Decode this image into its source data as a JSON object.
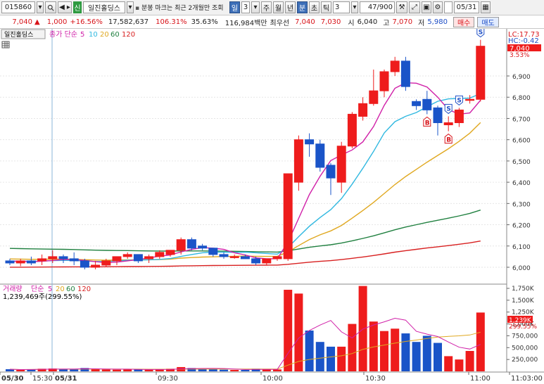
{
  "toolbar": {
    "code": "015860",
    "market_badge": "신",
    "stock_name": "일진홀딩스",
    "marker_notice": "분봉 마크는 최근 2개월만 조회",
    "period_day": "일",
    "period_n": "3",
    "period_week": "주",
    "period_month": "월",
    "period_year": "년",
    "period_minute": "분",
    "period_second": "초",
    "period_tick": "틱",
    "interval": "3",
    "count": "47/900",
    "date": "05/31"
  },
  "quote": {
    "price": "7,040",
    "arrow": "▲",
    "change": "1,000",
    "change_pct": "+16.56%",
    "volume": "17,582,637",
    "volume_ratio": "106.31%",
    "turnover": "35.63%",
    "amount": "116,984백만",
    "best_ask_label": "최우선",
    "best_ask": "7,040",
    "best_bid": "7,030",
    "open_label": "시",
    "open": "6,040",
    "high_label": "고",
    "high": "7,070",
    "low_label": "저",
    "low": "5,980",
    "buy_label": "매수",
    "sell_label": "매도"
  },
  "price_panel": {
    "name_tag": "일진홀딩스",
    "ma_label": "종가 단순",
    "ma_periods": [
      "5",
      "10",
      "20",
      "60",
      "120"
    ],
    "hc_lc": [
      "LC:17.73",
      "HC:-0.42"
    ],
    "last_price_tag": "7,040",
    "last_pct_tag": "3.53%",
    "marker_s": "S",
    "marker_b": "B"
  },
  "volume_panel": {
    "title": "거래량",
    "ma_label": "단순",
    "ma_periods": [
      "5",
      "20",
      "60",
      "120"
    ],
    "info": "1,239,469주(299.55%)",
    "last_vol_tag": "1,239K",
    "last_pct_tag": "299.55%"
  },
  "colors": {
    "up": "#ee1c1c",
    "down": "#1a54c8",
    "ma5": "#d020a8",
    "ma10": "#30b8e0",
    "ma20": "#e0a820",
    "ma60": "#208040",
    "ma120": "#d82020"
  },
  "chart_data": {
    "type": "candlestick",
    "price_axis": {
      "ticks": [
        6000,
        6100,
        6200,
        6300,
        6400,
        6500,
        6600,
        6700,
        6800,
        6900
      ],
      "tick_labels": [
        "6,000",
        "6,100",
        "6,200",
        "6,300",
        "6,400",
        "6,500",
        "6,600",
        "6,700",
        "6,800",
        "6,900"
      ]
    },
    "volume_axis": {
      "ticks": [
        250000,
        500000,
        750000,
        1000000,
        1250000,
        1500000,
        1750000
      ],
      "tick_labels": [
        "250,000",
        "500,000",
        "750,000",
        "1,000K",
        "1,250K",
        "1,500K",
        "1,750K"
      ]
    },
    "time_labels": [
      "05/30",
      "15:30",
      "05/31",
      "09:30",
      "10:00",
      "10:30",
      "11:00",
      "11:03:00"
    ],
    "candles": [
      {
        "o": 6030,
        "h": 6040,
        "l": 6010,
        "c": 6020,
        "v": 45000
      },
      {
        "o": 6020,
        "h": 6040,
        "l": 6005,
        "c": 6030,
        "v": 30000
      },
      {
        "o": 6030,
        "h": 6050,
        "l": 6010,
        "c": 6020,
        "v": 40000
      },
      {
        "o": 6030,
        "h": 6060,
        "l": 6010,
        "c": 6040,
        "v": 55000
      },
      {
        "o": 6040,
        "h": 6080,
        "l": 6020,
        "c": 6050,
        "v": 60000
      },
      {
        "o": 6050,
        "h": 6060,
        "l": 6020,
        "c": 6040,
        "v": 50000
      },
      {
        "o": 6040,
        "h": 6070,
        "l": 6010,
        "c": 6030,
        "v": 40000
      },
      {
        "o": 6030,
        "h": 6040,
        "l": 5990,
        "c": 6000,
        "v": 70000
      },
      {
        "o": 6000,
        "h": 6030,
        "l": 5990,
        "c": 6010,
        "v": 45000
      },
      {
        "o": 6010,
        "h": 6040,
        "l": 6000,
        "c": 6030,
        "v": 40000
      },
      {
        "o": 6030,
        "h": 6050,
        "l": 6010,
        "c": 6050,
        "v": 35000
      },
      {
        "o": 6050,
        "h": 6070,
        "l": 6040,
        "c": 6060,
        "v": 40000
      },
      {
        "o": 6060,
        "h": 6060,
        "l": 6020,
        "c": 6030,
        "v": 40000
      },
      {
        "o": 6040,
        "h": 6060,
        "l": 6020,
        "c": 6050,
        "v": 35000
      },
      {
        "o": 6050,
        "h": 6080,
        "l": 6040,
        "c": 6070,
        "v": 40000
      },
      {
        "o": 6060,
        "h": 6080,
        "l": 6050,
        "c": 6080,
        "v": 55000
      },
      {
        "o": 6080,
        "h": 6140,
        "l": 6060,
        "c": 6130,
        "v": 90000
      },
      {
        "o": 6130,
        "h": 6140,
        "l": 6080,
        "c": 6090,
        "v": 70000
      },
      {
        "o": 6100,
        "h": 6110,
        "l": 6080,
        "c": 6090,
        "v": 50000
      },
      {
        "o": 6090,
        "h": 6090,
        "l": 6050,
        "c": 6060,
        "v": 50000
      },
      {
        "o": 6060,
        "h": 6070,
        "l": 6040,
        "c": 6050,
        "v": 35000
      },
      {
        "o": 6050,
        "h": 6060,
        "l": 6040,
        "c": 6050,
        "v": 30000
      },
      {
        "o": 6050,
        "h": 6060,
        "l": 6040,
        "c": 6040,
        "v": 30000
      },
      {
        "o": 6040,
        "h": 6050,
        "l": 6010,
        "c": 6020,
        "v": 55000
      },
      {
        "o": 6020,
        "h": 6040,
        "l": 6010,
        "c": 6040,
        "v": 50000
      },
      {
        "o": 6040,
        "h": 6050,
        "l": 6030,
        "c": 6050,
        "v": 40000
      },
      {
        "o": 6040,
        "h": 6440,
        "l": 6030,
        "c": 6440,
        "v": 1720000
      },
      {
        "o": 6400,
        "h": 6620,
        "l": 6360,
        "c": 6600,
        "v": 1640000
      },
      {
        "o": 6600,
        "h": 6630,
        "l": 6520,
        "c": 6580,
        "v": 860000
      },
      {
        "o": 6580,
        "h": 6600,
        "l": 6450,
        "c": 6470,
        "v": 620000
      },
      {
        "o": 6480,
        "h": 6490,
        "l": 6340,
        "c": 6420,
        "v": 520000
      },
      {
        "o": 6400,
        "h": 6590,
        "l": 6350,
        "c": 6570,
        "v": 520000
      },
      {
        "o": 6570,
        "h": 6730,
        "l": 6560,
        "c": 6720,
        "v": 1000000
      },
      {
        "o": 6710,
        "h": 6800,
        "l": 6690,
        "c": 6770,
        "v": 1800000
      },
      {
        "o": 6770,
        "h": 6930,
        "l": 6760,
        "c": 6830,
        "v": 1050000
      },
      {
        "o": 6830,
        "h": 6930,
        "l": 6800,
        "c": 6920,
        "v": 850000
      },
      {
        "o": 6920,
        "h": 6990,
        "l": 6900,
        "c": 6970,
        "v": 900000
      },
      {
        "o": 6970,
        "h": 6990,
        "l": 6830,
        "c": 6850,
        "v": 800000
      },
      {
        "o": 6780,
        "h": 6790,
        "l": 6740,
        "c": 6760,
        "v": 620000
      },
      {
        "o": 6790,
        "h": 6830,
        "l": 6720,
        "c": 6740,
        "v": 750000
      },
      {
        "o": 6750,
        "h": 6760,
        "l": 6620,
        "c": 6680,
        "v": 600000
      },
      {
        "o": 6670,
        "h": 6710,
        "l": 6640,
        "c": 6680,
        "v": 320000
      },
      {
        "o": 6680,
        "h": 6750,
        "l": 6660,
        "c": 6740,
        "v": 250000
      },
      {
        "o": 6790,
        "h": 6810,
        "l": 6770,
        "c": 6790,
        "v": 430000
      },
      {
        "o": 6790,
        "h": 7070,
        "l": 6780,
        "c": 7040,
        "v": 1240000
      }
    ],
    "markers": [
      {
        "index": 39,
        "type": "B"
      },
      {
        "index": 41,
        "type": "B"
      },
      {
        "index": 41,
        "type": "S"
      },
      {
        "index": 42,
        "type": "S"
      },
      {
        "index": 44,
        "type": "S"
      }
    ]
  }
}
